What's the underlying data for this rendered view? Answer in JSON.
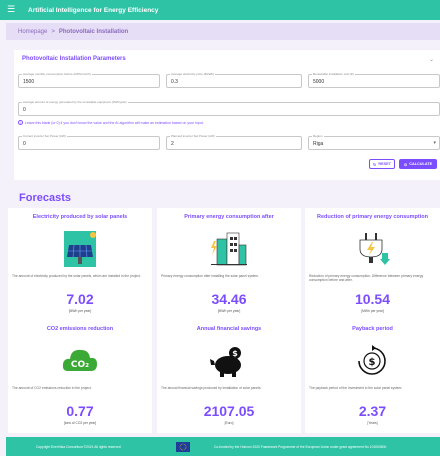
{
  "app": {
    "title": "Artificial Intelligence for Energy Efficiency"
  },
  "breadcrumb": {
    "home": "Homepage",
    "separator": ">",
    "current": "Photovoltaic Installation"
  },
  "params": {
    "title": "Photovoltaic Installation Parameters",
    "fields": {
      "consumption": {
        "label": "Average monthly consumption before (kWh/month)",
        "value": "1500"
      },
      "price": {
        "label": "Average electricity price (€/kWh)",
        "value": "0.3"
      },
      "install_cost": {
        "label": "Renewable installation cost (€)",
        "value": "5000"
      },
      "generated": {
        "label": "Average amount of energy generated by the renewable equipment (kWh/year)",
        "value": "0"
      },
      "current_inverter": {
        "label": "Current inverter Set Power (kW)",
        "value": "0"
      },
      "planned_inverter": {
        "label": "Planned inverter Set Power (kW)",
        "value": "2"
      },
      "region": {
        "label": "Region",
        "value": "Riga"
      }
    },
    "info_text": "Leave this blank (or 0) if you don't know the value and the AI algorithm will make an estimation based on your input.",
    "reset_label": "RESET",
    "calculate_label": "CALCULATE"
  },
  "forecasts": {
    "title": "Forecasts",
    "cards": [
      {
        "title": "Electricity produced by solar panels",
        "icon": "solar-panel-icon",
        "desc": "The amount of electricity produced by the solar panels, which are installed in the project.",
        "value": "7.02",
        "unit": "[MWh per year]"
      },
      {
        "title": "Primary energy consumption after",
        "icon": "building-energy-icon",
        "desc": "Primary energy consumption after installing the solar panel system.",
        "value": "34.46",
        "unit": "[MWh per year]"
      },
      {
        "title": "Reduction of primary energy consumption",
        "icon": "plug-down-icon",
        "desc": "Reduction of primary energy consumption. Difference between primary energy consumption before and after.",
        "value": "10.54",
        "unit": "[MWh per year]"
      },
      {
        "title": "CO2 emissions reduction",
        "icon": "co2-cloud-icon",
        "desc": "The amount of CO2 emissions reduction in the project.",
        "value": "0.77",
        "unit": "[tons of CO2 per year]"
      },
      {
        "title": "Annual financial savings",
        "icon": "piggy-bank-icon",
        "desc": "The annual financial savings produced by installation of solar panels.",
        "value": "2107.05",
        "unit": "[Euro]"
      },
      {
        "title": "Payback period",
        "icon": "dollar-cycle-icon",
        "desc": "The payback period of the investment in the solar panel system.",
        "value": "2.37",
        "unit": "[Years]"
      }
    ]
  },
  "footer": {
    "copyright": "Copyright EnerVisia Consortium ©2021 All rights reserved",
    "funded": "Co-funded by the Horizon 2020 Framework Programme of the European Union under grant agreement No 101000600"
  },
  "colors": {
    "accent": "#7c4dff",
    "header": "#2fc3a6",
    "breadcrumb_bg": "#e6ddf6",
    "page_bg": "#f4f1fb"
  }
}
